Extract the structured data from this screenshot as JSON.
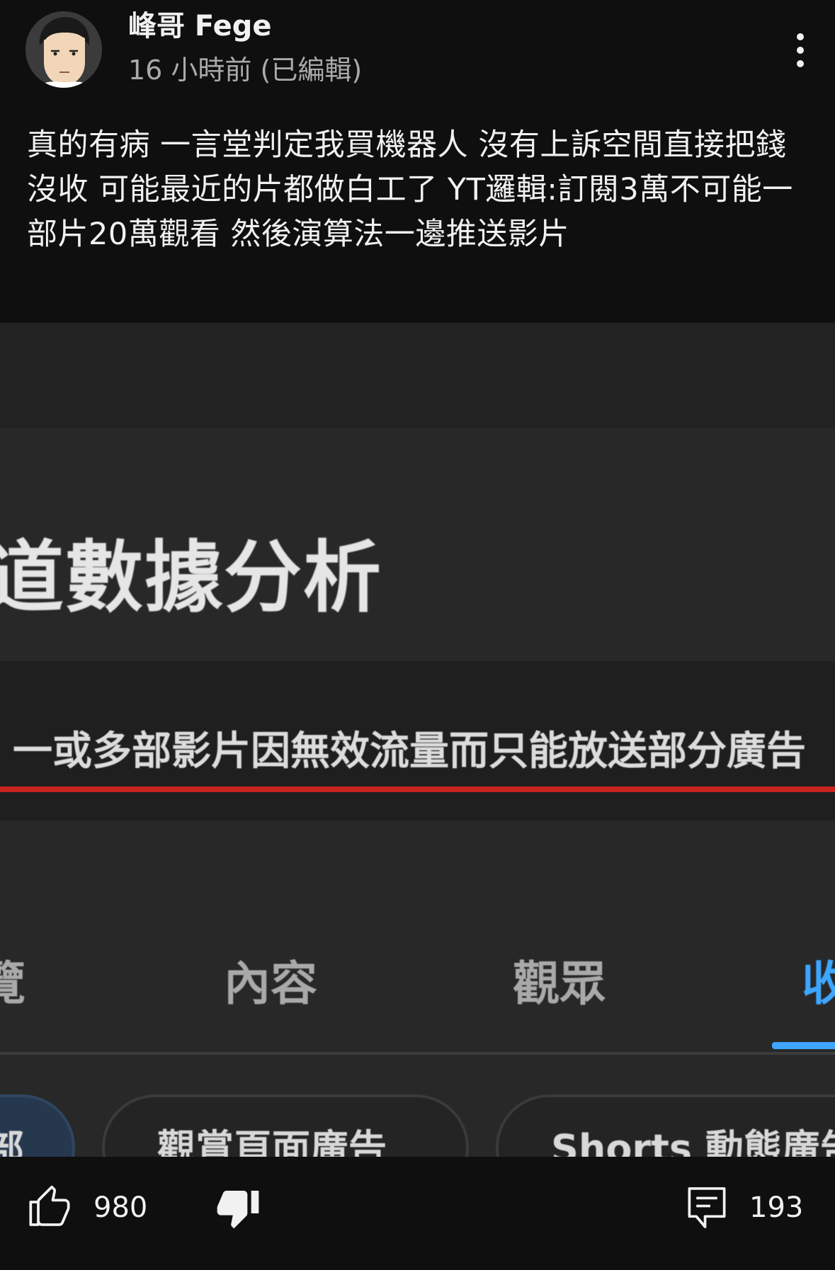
{
  "post": {
    "author": "峰哥 Fege",
    "meta": "16 小時前 (已編輯)",
    "text": "真的有病 一言堂判定我買機器人 沒有上訴空間直接把錢沒收 可能最近的片都做白工了 YT邏輯:訂閱3萬不可能一部片20萬觀看 然後演算法一邊推送影片"
  },
  "image": {
    "title": "道數據分析",
    "notice": "一或多部影片因無效流量而只能放送部分廣告",
    "tabs": [
      {
        "label": "覽",
        "active": false
      },
      {
        "label": "內容",
        "active": false
      },
      {
        "label": "觀眾",
        "active": false
      },
      {
        "label": "收",
        "active": true
      }
    ],
    "chips": [
      {
        "label": "部",
        "active": true
      },
      {
        "label": "觀賞頁面廣告",
        "active": false
      },
      {
        "label": "Shorts 動態廣告",
        "active": false
      }
    ]
  },
  "actions": {
    "like_count": "980",
    "comment_count": "193"
  },
  "colors": {
    "background": "#0f0f0f",
    "text": "#f1f1f1",
    "secondary_text": "#aaaaaa",
    "accent_blue": "#3ea6ff",
    "alert_red": "#c8231d"
  },
  "icons": {
    "more": "more-vert-icon",
    "like": "thumbs-up-icon",
    "dislike": "thumbs-down-icon",
    "comment": "comment-icon"
  }
}
